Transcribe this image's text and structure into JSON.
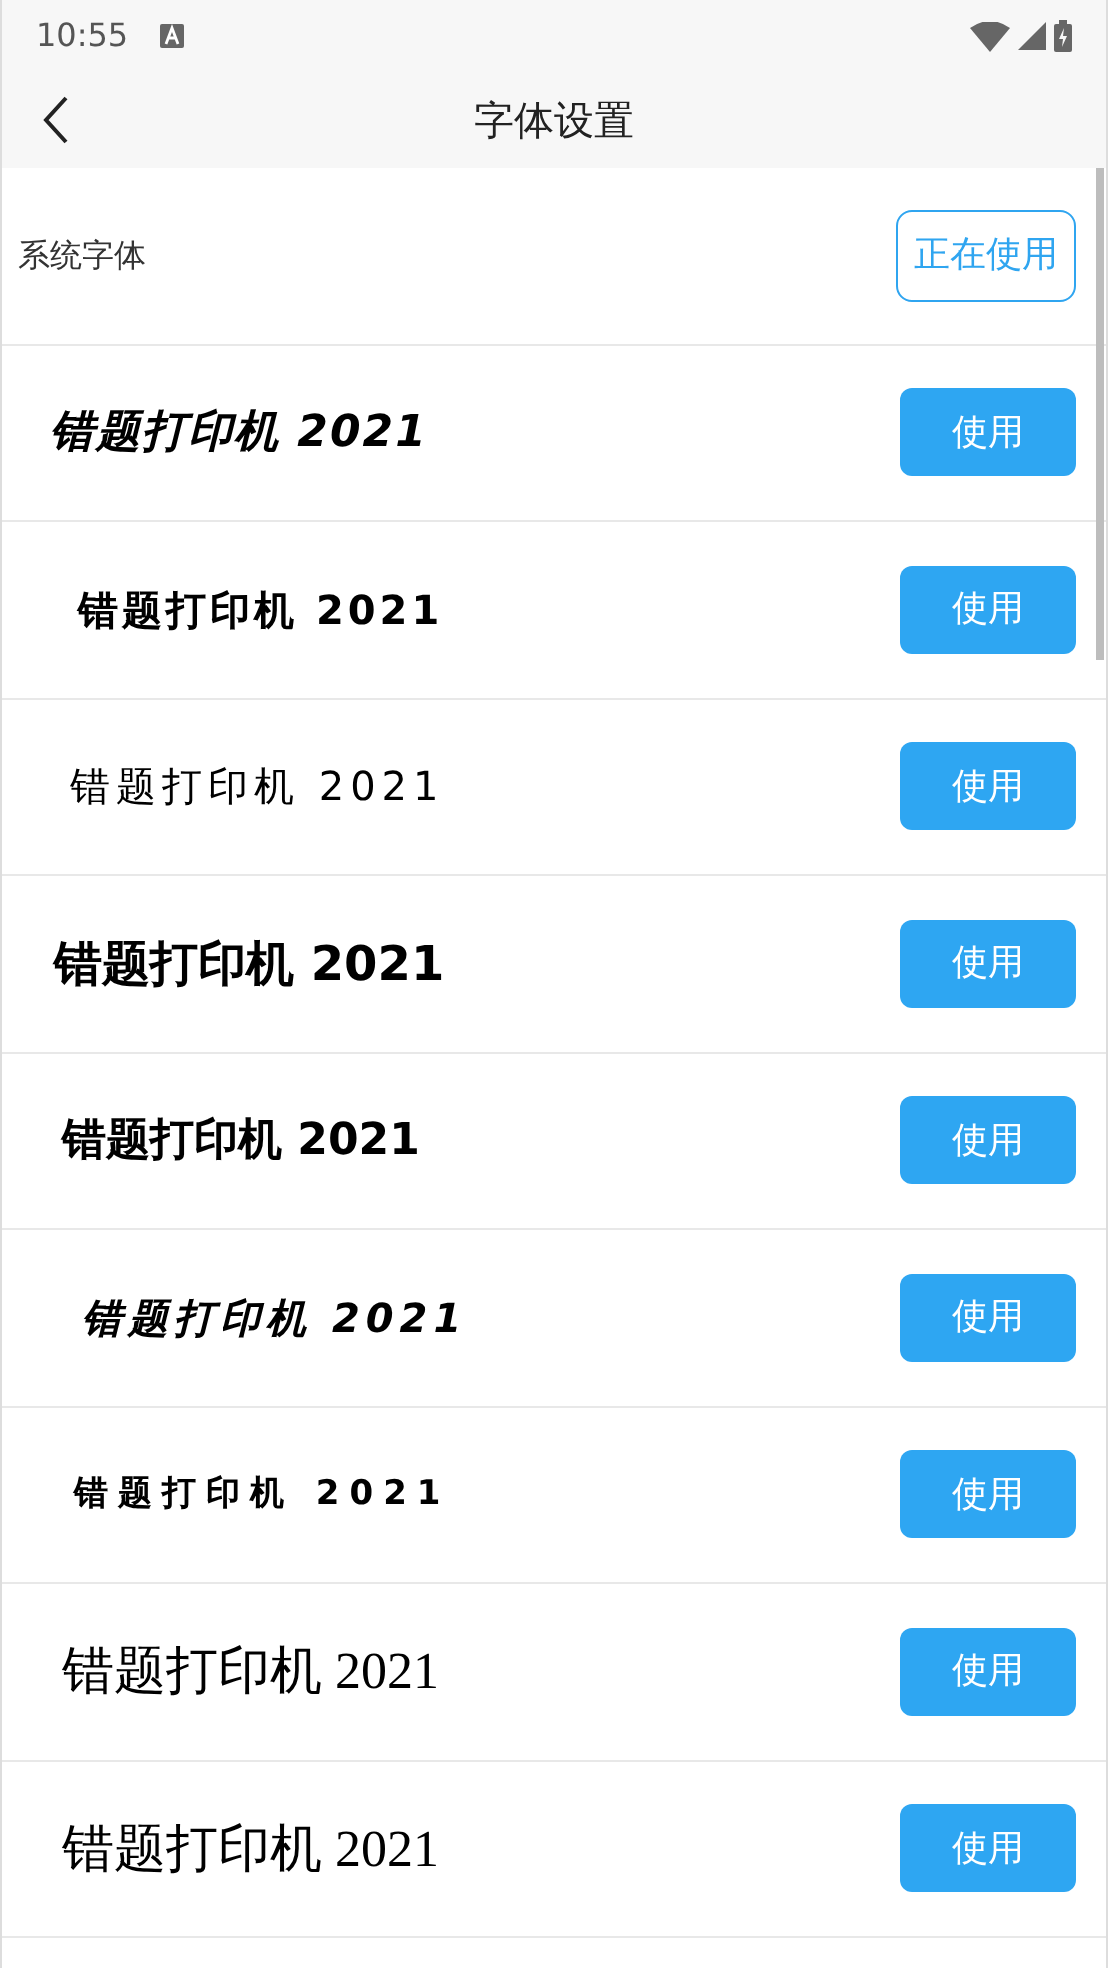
{
  "status_bar": {
    "time": "10:55"
  },
  "toolbar": {
    "title": "字体设置"
  },
  "fonts": [
    {
      "kind": "system",
      "name": "系统字体",
      "button": "正在使用",
      "selected": true
    },
    {
      "kind": "sample",
      "name": "错题打印机 2021",
      "button": "使用",
      "selected": false
    },
    {
      "kind": "sample",
      "name": "错题打印机 2021",
      "button": "使用",
      "selected": false
    },
    {
      "kind": "sample",
      "name": "错题打印机 2021",
      "button": "使用",
      "selected": false
    },
    {
      "kind": "sample",
      "name": "错题打印机 2021",
      "button": "使用",
      "selected": false
    },
    {
      "kind": "sample",
      "name": "错题打印机 2021",
      "button": "使用",
      "selected": false
    },
    {
      "kind": "sample",
      "name": "错题打印机 2021",
      "button": "使用",
      "selected": false
    },
    {
      "kind": "sample",
      "name": "错题打印机 2021",
      "button": "使用",
      "selected": false
    },
    {
      "kind": "sample",
      "name": "错题打印机 2021",
      "button": "使用",
      "selected": false
    },
    {
      "kind": "sample",
      "name": "错题打印机 2021",
      "button": "使用",
      "selected": false
    }
  ]
}
